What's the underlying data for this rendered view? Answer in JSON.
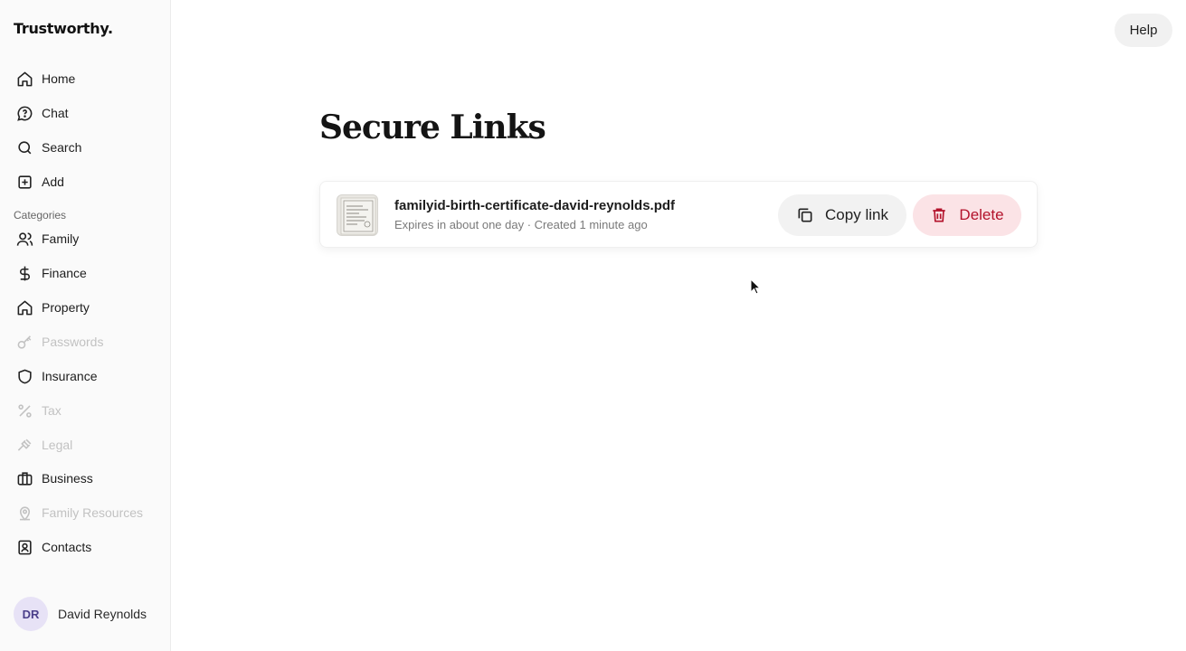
{
  "app": {
    "logo": "Trustworthy."
  },
  "header": {
    "help_label": "Help"
  },
  "sidebar": {
    "nav": [
      {
        "label": "Home",
        "icon": "home-icon"
      },
      {
        "label": "Chat",
        "icon": "chat-icon"
      },
      {
        "label": "Search",
        "icon": "search-icon"
      },
      {
        "label": "Add",
        "icon": "plus-square-icon"
      }
    ],
    "categories_label": "Categories",
    "categories": [
      {
        "label": "Family",
        "icon": "users-icon",
        "enabled": true
      },
      {
        "label": "Finance",
        "icon": "dollar-icon",
        "enabled": true
      },
      {
        "label": "Property",
        "icon": "home-icon",
        "enabled": true
      },
      {
        "label": "Passwords",
        "icon": "key-icon",
        "enabled": false
      },
      {
        "label": "Insurance",
        "icon": "shield-icon",
        "enabled": true
      },
      {
        "label": "Tax",
        "icon": "percent-icon",
        "enabled": false
      },
      {
        "label": "Legal",
        "icon": "gavel-icon",
        "enabled": false
      },
      {
        "label": "Business",
        "icon": "briefcase-icon",
        "enabled": true
      },
      {
        "label": "Family Resources",
        "icon": "map-pin-icon",
        "enabled": false
      },
      {
        "label": "Contacts",
        "icon": "contact-book-icon",
        "enabled": true
      }
    ],
    "user": {
      "initials": "DR",
      "name": "David Reynolds"
    }
  },
  "main": {
    "title": "Secure Links",
    "links": [
      {
        "file_name": "familyid-birth-certificate-david-reynolds.pdf",
        "meta": "Expires in about one day · Created 1 minute ago",
        "copy_label": "Copy link",
        "delete_label": "Delete"
      }
    ]
  },
  "colors": {
    "delete_bg": "#fbe3e6",
    "delete_text": "#b3122b",
    "avatar_bg": "#e7e2f6",
    "disabled_text": "#c2c2c2"
  }
}
